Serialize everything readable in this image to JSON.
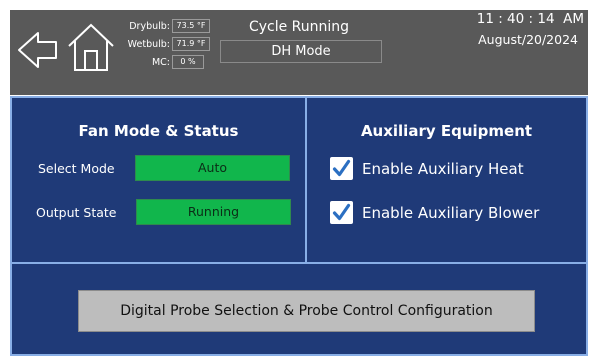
{
  "header": {
    "sensors": [
      {
        "label": "Drybulb:",
        "value": "73.5 °F"
      },
      {
        "label": "Wetbulb:",
        "value": "71.9 °F"
      },
      {
        "label": "MC:",
        "value": "0 %"
      }
    ],
    "cycle_status": "Cycle Running",
    "mode": "DH Mode",
    "time": "11 : 40 : 14  AM",
    "date": "August/20/2024"
  },
  "fan_panel": {
    "title": "Fan Mode & Status",
    "select_mode_label": "Select Mode",
    "select_mode_value": "Auto",
    "output_state_label": "Output State",
    "output_state_value": "Running"
  },
  "aux_panel": {
    "title": "Auxiliary Equipment",
    "options": [
      {
        "label": "Enable Auxiliary Heat",
        "checked": true
      },
      {
        "label": "Enable Auxiliary Blower",
        "checked": true
      }
    ]
  },
  "config_button": {
    "label": "Digital Probe Selection & Probe Control Configuration"
  },
  "colors": {
    "header_bg": "#595959",
    "panel_bg": "#1f3a78",
    "panel_border": "#88aee6",
    "status_green": "#11b64c",
    "checkbox_check": "#2b6fc2",
    "button_bg": "#bdbdbd"
  },
  "icons": [
    "back-arrow-icon",
    "home-icon",
    "checkmark-icon"
  ]
}
